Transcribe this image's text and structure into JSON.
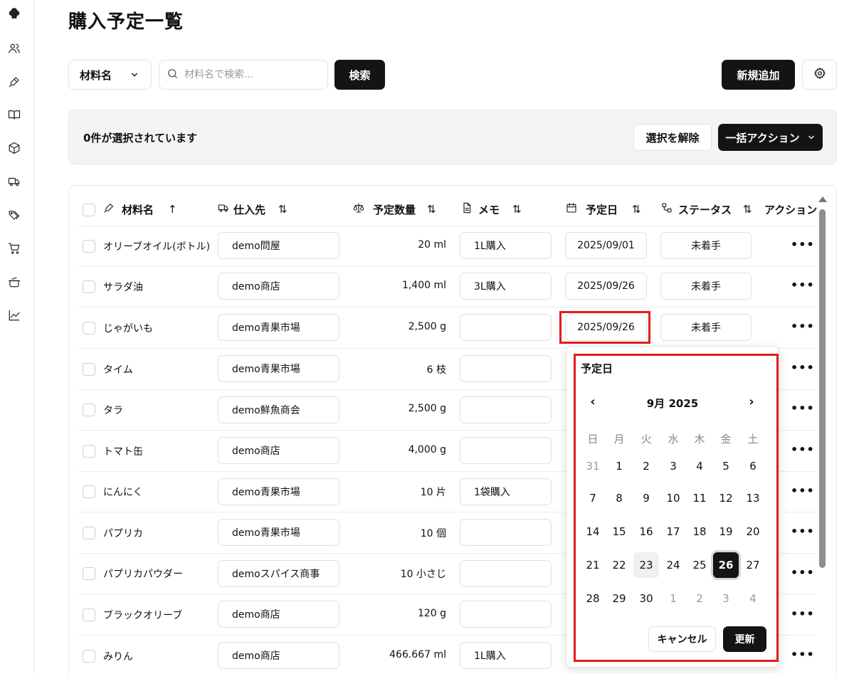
{
  "page": {
    "title": "購入予定一覧"
  },
  "toolbar": {
    "field_select": "材料名",
    "search_placeholder": "材料名で検索...",
    "search_label": "検索",
    "add_label": "新規追加"
  },
  "selection": {
    "count_text": "0件が選択されています",
    "clear_label": "選択を解除",
    "bulk_label": "一括アクション"
  },
  "table": {
    "headers": {
      "name": "材料名",
      "supplier": "仕入先",
      "qty": "予定数量",
      "memo": "メモ",
      "date": "予定日",
      "status": "ステータス",
      "action": "アクション"
    },
    "sort_asc": "↑",
    "sort_both": "⇅",
    "more": "•••",
    "rows": [
      {
        "name": "オリーブオイル(ボトル)",
        "supplier": "demo問屋",
        "qty": "20 ml",
        "memo": "1L購入",
        "date": "2025/09/01",
        "status": "未着手"
      },
      {
        "name": "サラダ油",
        "supplier": "demo商店",
        "qty": "1,400 ml",
        "memo": "3L購入",
        "date": "2025/09/26",
        "status": "未着手"
      },
      {
        "name": "じゃがいも",
        "supplier": "demo青果市場",
        "qty": "2,500 g",
        "memo": "",
        "date": "2025/09/26",
        "status": "未着手"
      },
      {
        "name": "タイム",
        "supplier": "demo青果市場",
        "qty": "6 枝",
        "memo": "",
        "date": "",
        "status": ""
      },
      {
        "name": "タラ",
        "supplier": "demo鮮魚商会",
        "qty": "2,500 g",
        "memo": "",
        "date": "",
        "status": ""
      },
      {
        "name": "トマト缶",
        "supplier": "demo商店",
        "qty": "4,000 g",
        "memo": "",
        "date": "",
        "status": ""
      },
      {
        "name": "にんにく",
        "supplier": "demo青果市場",
        "qty": "10 片",
        "memo": "1袋購入",
        "date": "",
        "status": ""
      },
      {
        "name": "パプリカ",
        "supplier": "demo青果市場",
        "qty": "10 個",
        "memo": "",
        "date": "",
        "status": ""
      },
      {
        "name": "パプリカパウダー",
        "supplier": "demoスパイス商事",
        "qty": "10 小さじ",
        "memo": "",
        "date": "",
        "status": ""
      },
      {
        "name": "ブラックオリーブ",
        "supplier": "demo商店",
        "qty": "120 g",
        "memo": "",
        "date": "",
        "status": ""
      },
      {
        "name": "みりん",
        "supplier": "demo商店",
        "qty": "466.667 ml",
        "memo": "1L購入",
        "date": "",
        "status": ""
      }
    ]
  },
  "datepicker": {
    "title": "予定日",
    "month_label": "9月 2025",
    "prev": "‹",
    "next": "›",
    "weekdays": [
      "日",
      "月",
      "火",
      "水",
      "木",
      "金",
      "土"
    ],
    "weeks": [
      [
        "31",
        "1",
        "2",
        "3",
        "4",
        "5",
        "6"
      ],
      [
        "7",
        "8",
        "9",
        "10",
        "11",
        "12",
        "13"
      ],
      [
        "14",
        "15",
        "16",
        "17",
        "18",
        "19",
        "20"
      ],
      [
        "21",
        "22",
        "23",
        "24",
        "25",
        "26",
        "27"
      ],
      [
        "28",
        "29",
        "30",
        "1",
        "2",
        "3",
        "4"
      ]
    ],
    "cancel_label": "キャンセル",
    "update_label": "更新"
  },
  "sidebar": {
    "icons": [
      "chef-hat-icon",
      "users-icon",
      "pen-icon",
      "book-icon",
      "box-icon",
      "truck-icon",
      "tags-icon",
      "cart-icon",
      "pot-icon",
      "chart-icon"
    ]
  }
}
